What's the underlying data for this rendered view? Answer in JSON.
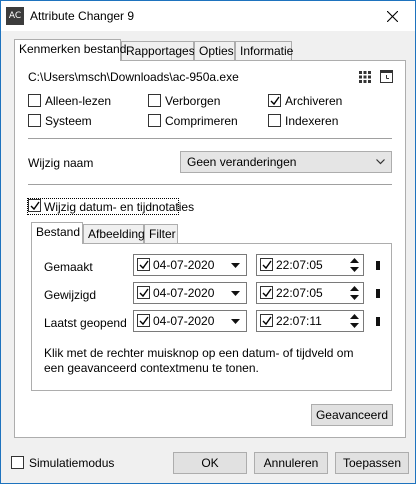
{
  "window": {
    "app_icon_text": "AC",
    "title": "Attribute Changer 9"
  },
  "tabs": [
    {
      "label": "Kenmerken bestand"
    },
    {
      "label": "Rapportages"
    },
    {
      "label": "Opties"
    },
    {
      "label": "Informatie"
    }
  ],
  "file_path": "C:\\Users\\msch\\Downloads\\ac-950a.exe",
  "attributes": [
    {
      "label": "Alleen-lezen",
      "checked": false
    },
    {
      "label": "Verborgen",
      "checked": false
    },
    {
      "label": "Archiveren",
      "checked": true
    },
    {
      "label": "Systeem",
      "checked": false
    },
    {
      "label": "Comprimeren",
      "checked": false
    },
    {
      "label": "Indexeren",
      "checked": false
    }
  ],
  "rename": {
    "label": "Wijzig naam",
    "value": "Geen veranderingen"
  },
  "datetime": {
    "label": "Wijzig datum- en tijdnotaties",
    "checked": true,
    "subtabs": [
      {
        "label": "Bestand"
      },
      {
        "label": "Afbeelding"
      },
      {
        "label": "Filter"
      }
    ],
    "rows": [
      {
        "label": "Gemaakt",
        "date": "04-07-2020",
        "time": "22:07:05"
      },
      {
        "label": "Gewijzigd",
        "date": "04-07-2020",
        "time": "22:07:05"
      },
      {
        "label": "Laatst geopend",
        "date": "04-07-2020",
        "time": "22:07:11"
      }
    ],
    "hint": "Klik met de rechter muisknop op een datum- of tijdveld om een geavanceerd contextmenu te tonen.",
    "advanced_button": "Geavanceerd"
  },
  "footer": {
    "simulation_label": "Simulatiemodus",
    "simulation_checked": false,
    "ok": "OK",
    "cancel": "Annuleren",
    "apply": "Toepassen"
  },
  "colors": {
    "accent": "#1e73be",
    "check": "#000000"
  }
}
